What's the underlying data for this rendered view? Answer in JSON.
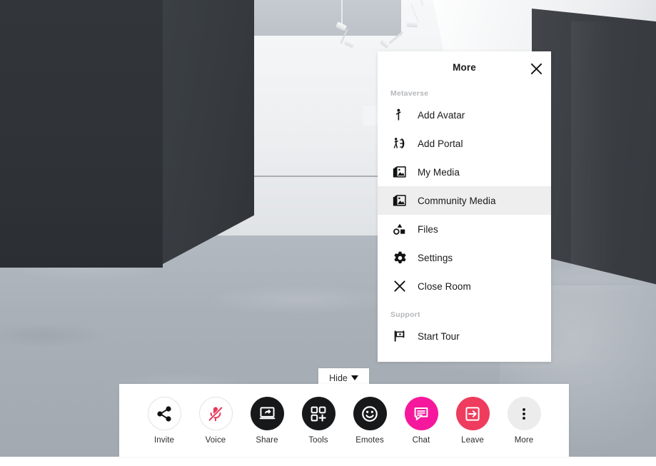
{
  "scene": {
    "add_media_placeholder": "+"
  },
  "panel": {
    "title": "More",
    "close_icon": "close-icon",
    "sections": [
      {
        "label": "Metaverse",
        "items": [
          {
            "label": "Add Avatar",
            "icon": "avatar-icon",
            "active": false
          },
          {
            "label": "Add Portal",
            "icon": "portal-icon",
            "active": false
          },
          {
            "label": "My Media",
            "icon": "image-stack-icon",
            "active": false
          },
          {
            "label": "Community Media",
            "icon": "image-stack-icon",
            "active": true
          },
          {
            "label": "Files",
            "icon": "shapes-icon",
            "active": false
          },
          {
            "label": "Settings",
            "icon": "gear-icon",
            "active": false
          },
          {
            "label": "Close Room",
            "icon": "close-icon",
            "active": false
          }
        ]
      },
      {
        "label": "Support",
        "items": [
          {
            "label": "Start Tour",
            "icon": "flag-icon",
            "active": false
          }
        ]
      }
    ]
  },
  "hide_button": {
    "label": "Hide",
    "caret_icon": "chevron-down-icon"
  },
  "toolbar": {
    "items": [
      {
        "label": "Invite",
        "icon": "share-nodes-icon",
        "style": "white",
        "bg": "#ffffff",
        "fg": "#111213"
      },
      {
        "label": "Voice",
        "icon": "mic-muted-icon",
        "style": "white",
        "bg": "#ffffff",
        "fg": "#e8385a"
      },
      {
        "label": "Share",
        "icon": "screen-share-icon",
        "style": "filled",
        "bg": "#17181a",
        "fg": "#ffffff"
      },
      {
        "label": "Tools",
        "icon": "grid-plus-icon",
        "style": "filled",
        "bg": "#17181a",
        "fg": "#ffffff"
      },
      {
        "label": "Emotes",
        "icon": "smiley-icon",
        "style": "filled",
        "bg": "#17181a",
        "fg": "#ffffff"
      },
      {
        "label": "Chat",
        "icon": "chat-bubble-icon",
        "style": "filled",
        "bg": "#f5189c",
        "fg": "#ffffff"
      },
      {
        "label": "Leave",
        "icon": "exit-icon",
        "style": "filled",
        "bg": "#ef3b5d",
        "fg": "#ffffff"
      },
      {
        "label": "More",
        "icon": "kebab-menu-icon",
        "style": "filled",
        "bg": "#ececec",
        "fg": "#111213"
      }
    ]
  },
  "colors": {
    "chat_magenta": "#f5189c",
    "leave_red": "#ef3b5d",
    "voice_muted_red": "#e8385a",
    "dark": "#17181a",
    "active_row": "#eeeeee",
    "section_label": "#b5b7ba"
  }
}
